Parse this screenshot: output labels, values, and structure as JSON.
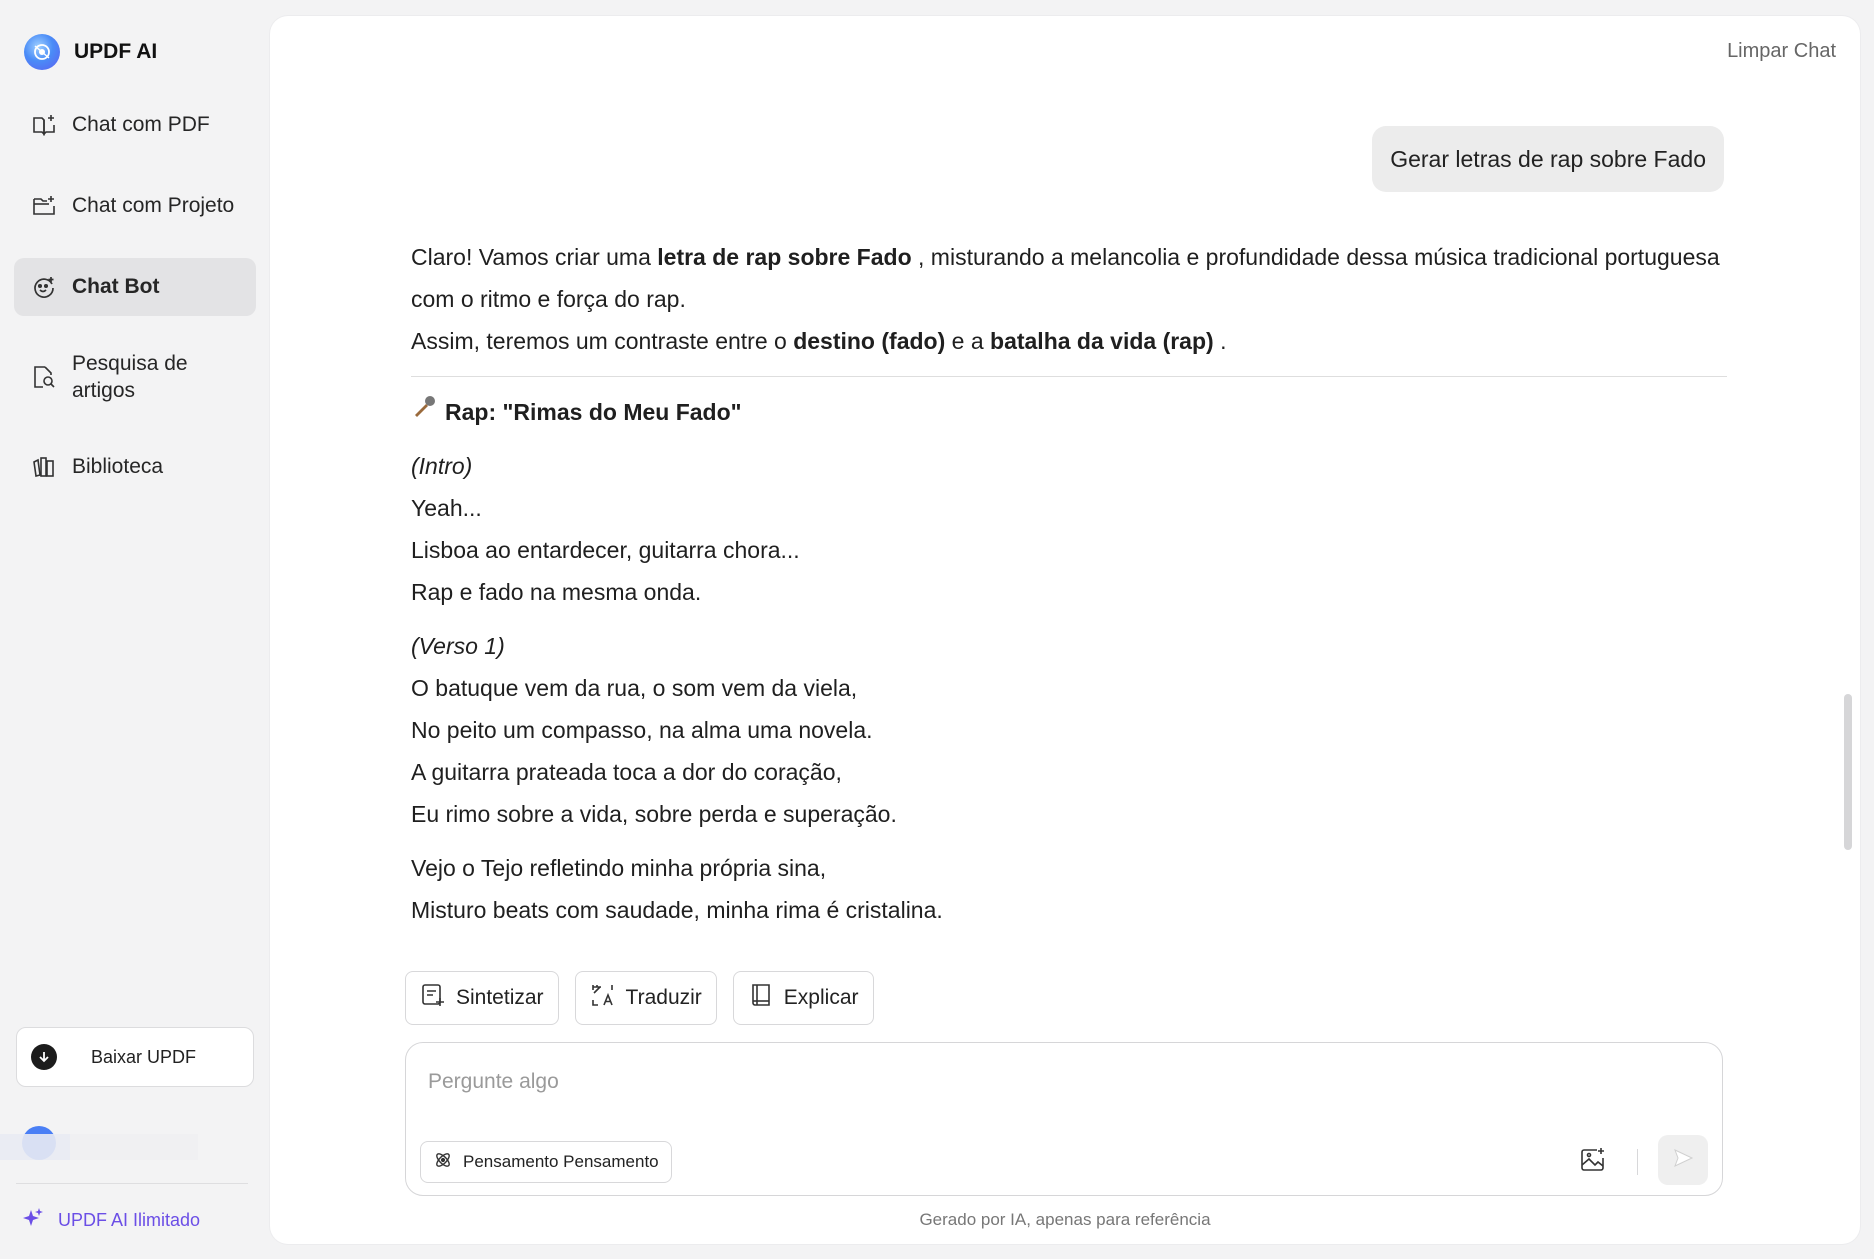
{
  "brand": {
    "name": "UPDF AI",
    "icon": "updf-logo-icon"
  },
  "nav": [
    {
      "label": "Chat com PDF",
      "icon": "book-sparkle-icon"
    },
    {
      "label": "Chat com Projeto",
      "icon": "folder-sparkle-icon"
    },
    {
      "label": "Chat Bot",
      "icon": "bot-face-icon",
      "active": true
    },
    {
      "label": "Pesquisa de artigos",
      "icon": "document-search-icon"
    },
    {
      "label": "Biblioteca",
      "icon": "library-icon"
    }
  ],
  "download": {
    "label": "Baixar UPDF",
    "icon": "download-icon"
  },
  "unlimited": {
    "label": "UPDF AI Ilimitado",
    "icon": "sparkle-icon"
  },
  "header": {
    "clear_chat": "Limpar Chat"
  },
  "conversation": {
    "user_message": "Gerar letras de rap sobre Fado",
    "answer": {
      "intro_parts": [
        "Claro! Vamos criar uma ",
        "letra de rap sobre Fado",
        " , misturando a melancolia e profundidade dessa música tradicional portuguesa com o ritmo e força do rap."
      ],
      "contrast_parts": [
        "Assim, teremos um contraste entre o ",
        "destino (fado)",
        " e a ",
        "batalha da vida (rap)",
        " ."
      ],
      "song_title": "Rap: \"Rimas do Meu Fado\"",
      "intro_label": "(Intro)",
      "intro_lines": [
        "Yeah...",
        "Lisboa ao entardecer, guitarra chora...",
        "Rap e fado na mesma onda."
      ],
      "verse1_label": "(Verso 1)",
      "verse1_lines": [
        "O batuque vem da rua, o som vem da viela,",
        "No peito um compasso, na alma uma novela.",
        "A guitarra prateada toca a dor do coração,",
        "Eu rimo sobre a vida, sobre perda e superação."
      ],
      "verse1b_lines": [
        "Vejo o Tejo refletindo minha própria sina,",
        "Misturo beats com saudade, minha rima é cristalina."
      ]
    }
  },
  "actions": [
    {
      "label": "Sintetizar",
      "icon": "summarize-icon"
    },
    {
      "label": "Traduzir",
      "icon": "translate-icon"
    },
    {
      "label": "Explicar",
      "icon": "book-icon"
    }
  ],
  "composer": {
    "placeholder": "Pergunte algo",
    "value": "",
    "thinking_label": "Pensamento Pensamento",
    "image_icon": "image-upload-icon",
    "send_icon": "send-icon"
  },
  "footnote": "Gerado por IA, apenas para referência"
}
